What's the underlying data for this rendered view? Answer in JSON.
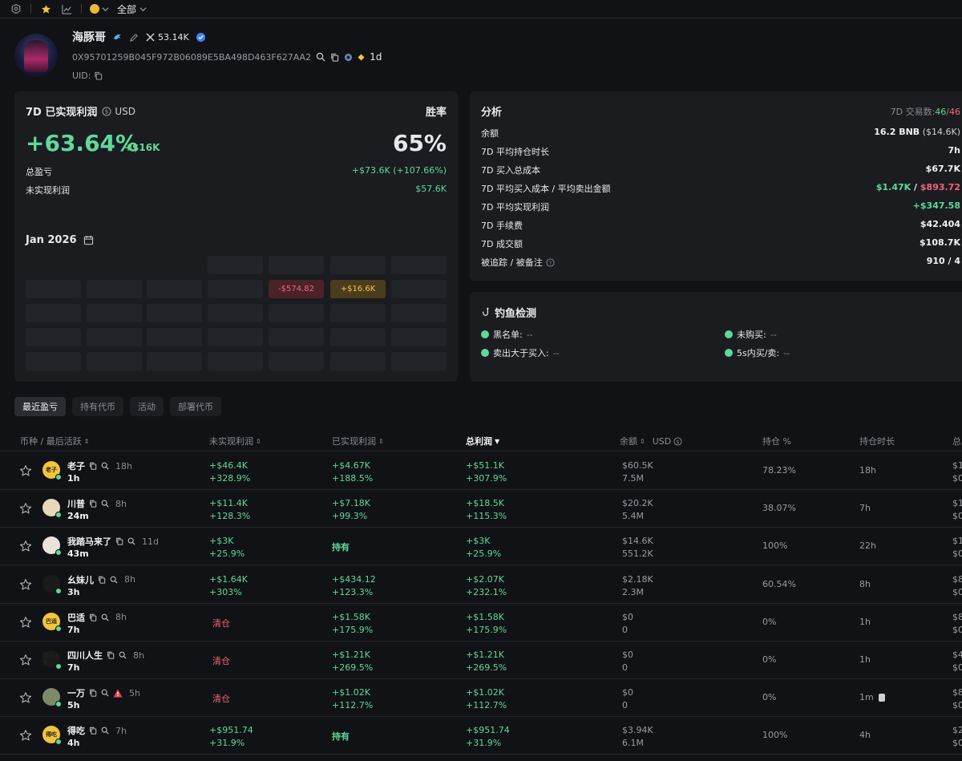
{
  "topbar": {
    "filter_label": "全部"
  },
  "profile": {
    "name": "海豚哥",
    "followers": "53.14K",
    "address": "0X95701259B045F972B06089E5BA498D463F627AA2",
    "age": "1d",
    "uid_label": "UID:"
  },
  "profit_panel": {
    "title": "7D 已实现利润",
    "unit": "USD",
    "win_label": "胜率",
    "big_pct": "+63.64%",
    "big_usd": "+$16K",
    "win_value": "65%",
    "rows": [
      {
        "label": "总盈亏",
        "value": "+$73.6K (+107.66%)"
      },
      {
        "label": "未实现利润",
        "value": "$57.6K"
      }
    ],
    "calendar_title": "Jan 2026",
    "calendar_neg": "-$574.82",
    "calendar_pos": "+$16.6K"
  },
  "analysis": {
    "title": "分析",
    "trades_label": "7D 交易数:",
    "trades_buy": "46",
    "trades_sep": "/",
    "trades_sell": "46",
    "rows": [
      {
        "label": "余额",
        "value": "16.2 BNB",
        "value2": " ($14.6K)"
      },
      {
        "label": "7D 平均持仓时长",
        "value": "7h"
      },
      {
        "label": "7D 买入总成本",
        "value": "$67.7K"
      },
      {
        "label": "7D 平均买入成本 / 平均卖出金额",
        "value_a": "$1.47K",
        "value_sep": " / ",
        "value_b": "$893.72"
      },
      {
        "label": "7D 平均实现利润",
        "value": "+$347.58"
      },
      {
        "label": "7D 手续费",
        "value": "$42.404"
      },
      {
        "label": "7D 成交额",
        "value": "$108.7K"
      },
      {
        "label": "被追踪 / 被备注",
        "value": "910 / 4"
      }
    ]
  },
  "phishing": {
    "title": "钓鱼检测",
    "items": [
      {
        "label": "黑名单:",
        "value": "--"
      },
      {
        "label": "未购买:",
        "value": "--"
      },
      {
        "label": "卖出大于买入:",
        "value": "--"
      },
      {
        "label": "5s内买/卖:",
        "value": "--"
      }
    ]
  },
  "tabs": [
    "最近盈亏",
    "持有代币",
    "活动",
    "部署代币"
  ],
  "table": {
    "headers": {
      "token": "币种 / 最后活跃",
      "unrealized": "未实现利润",
      "realized": "已实现利润",
      "total": "总利润",
      "balance": "余额",
      "balance_unit": "USD",
      "position": "持仓 %",
      "hold_time": "持仓时长",
      "extra": "总"
    },
    "rows": [
      {
        "name": "老子",
        "age": "18h",
        "last": "1h",
        "unr1": "+$46.4K",
        "unr2": "+328.9%",
        "rea1": "+$4.67K",
        "rea2": "+188.5%",
        "tot1": "+$51.1K",
        "tot2": "+307.9%",
        "bal1": "$60.5K",
        "bal2": "7.5M",
        "pos": "78.23%",
        "hold": "18h",
        "ex1": "$1",
        "ex2": "$0",
        "avatar_color": "#f2c53d",
        "avatar_text": "老子"
      },
      {
        "name": "川普",
        "age": "8h",
        "last": "24m",
        "unr1": "+$11.4K",
        "unr2": "+128.3%",
        "rea1": "+$7.18K",
        "rea2": "+99.3%",
        "tot1": "+$18.5K",
        "tot2": "+115.3%",
        "bal1": "$20.2K",
        "bal2": "5.4M",
        "pos": "38.07%",
        "hold": "7h",
        "ex1": "$1",
        "ex2": "$0",
        "avatar_color": "#e8d7b8",
        "avatar_text": ""
      },
      {
        "name": "我踏马来了",
        "age": "11d",
        "last": "43m",
        "unr1": "+$3K",
        "unr2": "+25.9%",
        "rea_hold": "持有",
        "tot1": "+$3K",
        "tot2": "+25.9%",
        "bal1": "$14.6K",
        "bal2": "551.2K",
        "pos": "100%",
        "hold": "22h",
        "ex1": "$1",
        "ex2": "$0",
        "avatar_color": "#e9e4da",
        "avatar_text": ""
      },
      {
        "name": "幺妹儿",
        "age": "8h",
        "last": "3h",
        "unr1": "+$1.64K",
        "unr2": "+303%",
        "rea1": "+$434.12",
        "rea2": "+123.3%",
        "tot1": "+$2.07K",
        "tot2": "+232.1%",
        "bal1": "$2.18K",
        "bal2": "2.3M",
        "pos": "60.54%",
        "hold": "8h",
        "ex1": "$8",
        "ex2": "$0",
        "avatar_color": "#1a1a1a",
        "avatar_text": ""
      },
      {
        "name": "巴适",
        "age": "8h",
        "last": "7h",
        "unr_clear": "清仓",
        "rea1": "+$1.58K",
        "rea2": "+175.9%",
        "tot1": "+$1.58K",
        "tot2": "+175.9%",
        "bal1": "$0",
        "bal2": "0",
        "pos": "0%",
        "hold": "1h",
        "ex1": "$8",
        "ex2": "$0",
        "avatar_color": "#f2c53d",
        "avatar_text": "巴适"
      },
      {
        "name": "四川人生",
        "age": "8h",
        "last": "7h",
        "unr_clear": "清仓",
        "rea1": "+$1.21K",
        "rea2": "+269.5%",
        "tot1": "+$1.21K",
        "tot2": "+269.5%",
        "bal1": "$0",
        "bal2": "0",
        "pos": "0%",
        "hold": "1h",
        "ex1": "$4",
        "ex2": "$0",
        "avatar_color": "#1a1a1a",
        "avatar_text": "四川人生"
      },
      {
        "name": "一万",
        "age": "5h",
        "last": "5h",
        "unr_clear": "清仓",
        "rea1": "+$1.02K",
        "rea2": "+112.7%",
        "tot1": "+$1.02K",
        "tot2": "+112.7%",
        "bal1": "$0",
        "bal2": "0",
        "pos": "0%",
        "hold": "1m",
        "ex1": "$8",
        "ex2": "$0",
        "avatar_color": "#7d8a6a",
        "avatar_text": "",
        "warn": true
      },
      {
        "name": "得吃",
        "age": "7h",
        "last": "4h",
        "unr1": "+$951.74",
        "unr2": "+31.9%",
        "rea_hold": "持有",
        "tot1": "+$951.74",
        "tot2": "+31.9%",
        "bal1": "$3.94K",
        "bal2": "6.1M",
        "pos": "100%",
        "hold": "4h",
        "ex1": "$2",
        "ex2": "$0",
        "avatar_color": "#f2c53d",
        "avatar_text": "得吃"
      }
    ]
  },
  "colors": {
    "positive": "#5ed99a",
    "negative": "#f0647a",
    "background": "#111215",
    "panel": "#1b1c20"
  }
}
